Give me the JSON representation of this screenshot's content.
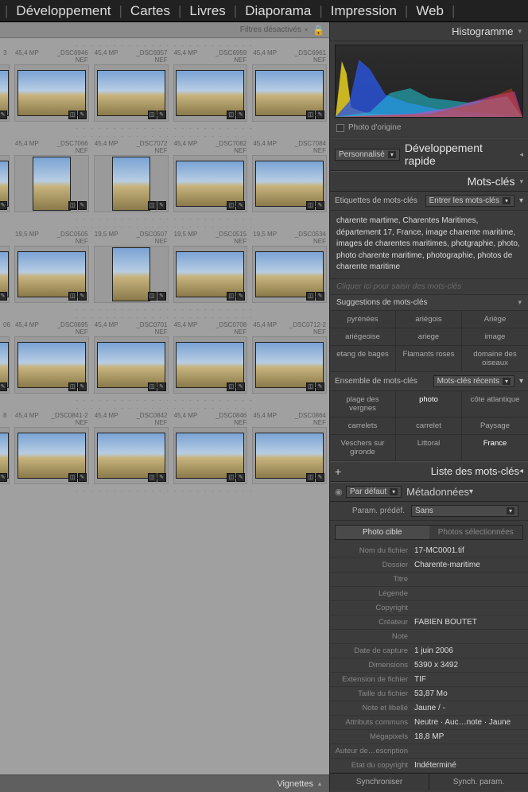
{
  "topnav": {
    "items": [
      "Développement",
      "Cartes",
      "Livres",
      "Diaporama",
      "Impression",
      "Web"
    ]
  },
  "filter": {
    "label": "Filtres désactivés"
  },
  "grid": {
    "rows": [
      {
        "first": {
          "mp": "3",
          "name": "",
          "ext": ""
        },
        "cells": [
          {
            "mp": "45,4 MP",
            "name": "_DSC6946",
            "ext": "NEF",
            "orient": "land"
          },
          {
            "mp": "45,4 MP",
            "name": "_DSC6957",
            "ext": "NEF",
            "orient": "land"
          },
          {
            "mp": "45,4 MP",
            "name": "_DSC6959",
            "ext": "NEF",
            "orient": "land"
          },
          {
            "mp": "45,4 MP",
            "name": "_DSC6961",
            "ext": "NEF",
            "orient": "land"
          }
        ]
      },
      {
        "first": {
          "mp": "",
          "name": "",
          "ext": ""
        },
        "cells": [
          {
            "mp": "45,4 MP",
            "name": "_DSC7066",
            "ext": "NEF",
            "orient": "port"
          },
          {
            "mp": "45,4 MP",
            "name": "_DSC7072",
            "ext": "NEF",
            "orient": "port"
          },
          {
            "mp": "45,4 MP",
            "name": "_DSC7082",
            "ext": "NEF",
            "orient": "land"
          },
          {
            "mp": "45,4 MP",
            "name": "_DSC7084",
            "ext": "NEF",
            "orient": "land"
          }
        ]
      },
      {
        "first": {
          "mp": "",
          "name": "",
          "ext": ""
        },
        "cells": [
          {
            "mp": "19,5 MP",
            "name": "_DSC0505",
            "ext": "NEF",
            "orient": "land"
          },
          {
            "mp": "19,5 MP",
            "name": "_DSC0507",
            "ext": "NEF",
            "orient": "port"
          },
          {
            "mp": "19,5 MP",
            "name": "_DSC0515",
            "ext": "NEF",
            "orient": "land"
          },
          {
            "mp": "19,5 MP",
            "name": "_DSC0534",
            "ext": "NEF",
            "orient": "land"
          }
        ]
      },
      {
        "first": {
          "mp": "06",
          "name": "",
          "ext": ""
        },
        "cells": [
          {
            "mp": "45,4 MP",
            "name": "_DSC0695",
            "ext": "NEF",
            "orient": "land"
          },
          {
            "mp": "45,4 MP",
            "name": "_DSC0701",
            "ext": "NEF",
            "orient": "land"
          },
          {
            "mp": "45,4 MP",
            "name": "_DSC0708",
            "ext": "NEF",
            "orient": "land"
          },
          {
            "mp": "45,4 MP",
            "name": "_DSC0712-2",
            "ext": "NEF",
            "orient": "land"
          }
        ]
      },
      {
        "first": {
          "mp": "8",
          "name": "",
          "ext": ""
        },
        "cells": [
          {
            "mp": "45,4 MP",
            "name": "_DSC0841-2",
            "ext": "NEF",
            "orient": "land"
          },
          {
            "mp": "45,4 MP",
            "name": "_DSC0842",
            "ext": "NEF",
            "orient": "land"
          },
          {
            "mp": "45,4 MP",
            "name": "_DSC0846",
            "ext": "NEF",
            "orient": "land"
          },
          {
            "mp": "45,4 MP",
            "name": "_DSC0864",
            "ext": "NEF",
            "orient": "land"
          }
        ]
      }
    ]
  },
  "bottom": {
    "vignettes": "Vignettes"
  },
  "panel": {
    "histogram": "Histogramme",
    "origin": "Photo d'origine",
    "quickdev": {
      "preset": "Personnalisé",
      "title": "Développement rapide"
    },
    "keywords": {
      "title": "Mots-clés",
      "tags_label": "Etiquettes de mots-clés",
      "enter_dd": "Entrer les mots-clés",
      "text": "charente martime, Charentes Maritimes, département 17, France, image charente maritime, images de charentes maritimes, photgraphie, photo, photo charente maritime, photographie, photos de charente maritime",
      "placeholder": "Cliquer ici pour saisir des mots-clés",
      "sugg_title": "Suggestions de mots-clés",
      "suggestions": [
        "pyrénées",
        "ariégois",
        "Ariège",
        "ariégeoise",
        "ariege",
        "image",
        "etang de bages",
        "Flamants roses",
        "domaine des oiseaux"
      ],
      "set_label": "Ensemble de mots-clés",
      "set_dd": "Mots-clés récents",
      "recent": [
        "plage des vergnes",
        "photo",
        "côte atlantique",
        "carrelets",
        "carrelet",
        "Paysage",
        "Veschers sur gironde",
        "Littoral",
        "France"
      ],
      "list_title": "Liste des mots-clés"
    },
    "metadata": {
      "title": "Métadonnées",
      "preset_dd": "Par défaut",
      "param_label": "Param. prédéf.",
      "param_value": "Sans",
      "tab_target": "Photo cible",
      "tab_selected": "Photos sélectionnées",
      "rows": [
        {
          "l": "Nom du fichier",
          "v": "17-MC0001.tif"
        },
        {
          "l": "Dossier",
          "v": "Charente-maritime"
        },
        {
          "l": "Titre",
          "v": ""
        },
        {
          "l": "Légende",
          "v": ""
        },
        {
          "l": "Copyright",
          "v": ""
        },
        {
          "l": "Créateur",
          "v": "FABIEN BOUTET"
        },
        {
          "l": "Note",
          "v": ""
        },
        {
          "l": "Date de capture",
          "v": "1 juin 2006"
        },
        {
          "l": "Dimensions",
          "v": "5390 x 3492"
        },
        {
          "l": "Extension de fichier",
          "v": "TIF"
        },
        {
          "l": "Taille du fichier",
          "v": "53,87 Mo"
        },
        {
          "l": "Note et libellé",
          "v": "Jaune / -"
        },
        {
          "l": "Attributs communs",
          "v": "Neutre · Auc…note · Jaune"
        },
        {
          "l": "Mégapixels",
          "v": "18,8 MP"
        },
        {
          "l": "Auteur de…escription",
          "v": ""
        },
        {
          "l": "Etat du copyright",
          "v": "Indéterminé"
        }
      ]
    },
    "sync": {
      "sync": "Synchroniser",
      "sync_param": "Synch. param."
    }
  }
}
